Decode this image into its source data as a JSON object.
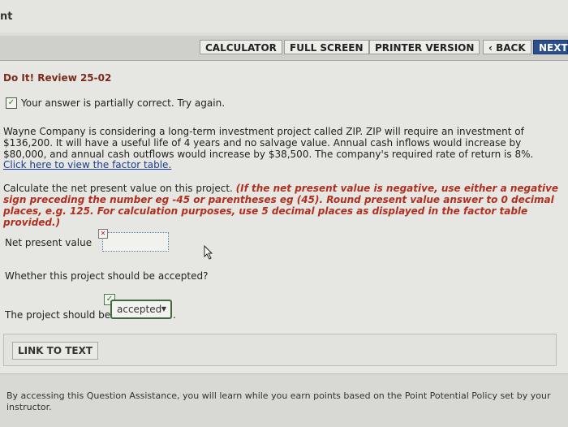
{
  "window": {
    "title_fragment": "nt"
  },
  "nav": {
    "calculator": "CALCULATOR",
    "full_screen": "FULL SCREEN",
    "printer_version": "PRINTER VERSION",
    "back": "‹ BACK",
    "next": "NEXT"
  },
  "page": {
    "heading": "Do It! Review 25-02",
    "status": "Your answer is partially correct.  Try again.",
    "problem": "Wayne Company is considering a long-term investment project called ZIP. ZIP will require an investment of $136,200. It will have a useful life of 4 years and no salvage value. Annual cash inflows would increase by $80,000, and annual cash outflows would increase by $38,500. The company's required rate of return is 8%.",
    "factor_link": "Click here to view the factor table.",
    "instruction_plain": "Calculate the net present value on this project. ",
    "instruction_red": "(If the net present value is negative, use either a negative sign preceding the number eg -45 or parentheses eg (45). Round present value answer to 0 decimal places, e.g. 125. For calculation purposes, use 5 decimal places as displayed in the factor table provided.)",
    "npv_label": "Net present value",
    "npv_value": "",
    "question": "Whether this project should be accepted?",
    "accept_label": "The project should be",
    "accept_value": "accepted",
    "link_to_text": "LINK TO TEXT"
  },
  "footer": {
    "text": "By accessing this Question Assistance, you will learn while you earn points based on the Point Potential Policy set by your instructor."
  },
  "icons": {
    "status_icon": "check-icon",
    "npv_status_icon": "x-icon",
    "accept_status_icon": "check-icon"
  }
}
